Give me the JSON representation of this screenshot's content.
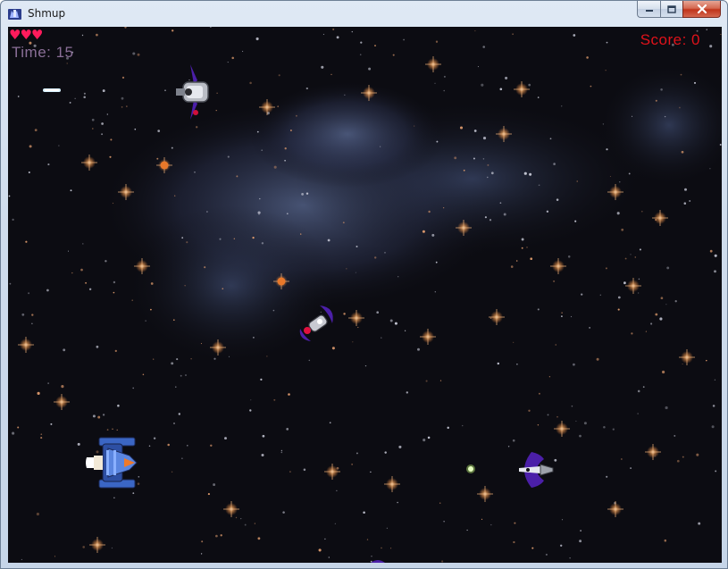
{
  "window": {
    "title": "Shmup",
    "icon": "game-ship-icon",
    "controls": [
      "minimize-icon",
      "maximize-icon",
      "close-icon"
    ]
  },
  "hud": {
    "lives": 3,
    "hearts": "♥♥♥",
    "time_text": "Time: 15",
    "score_text": "Score: 0",
    "heart_color": "#ff1b5c",
    "time_color": "#8a6f97",
    "score_color": "#e0121a"
  },
  "colors": {
    "space": "#0c0c12",
    "nebula": "#3d4a6e",
    "star_orange": "#e0803a",
    "enemy_purple": "#4b1fa8"
  }
}
